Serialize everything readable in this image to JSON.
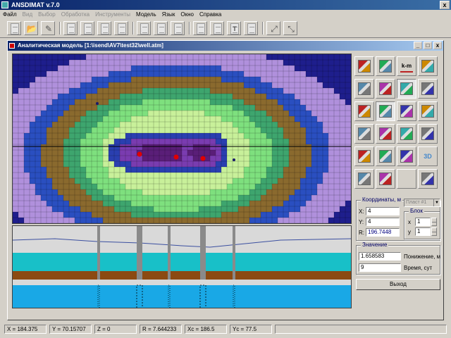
{
  "app": {
    "title": "ANSDIMAT v.7.0",
    "close_label": "x"
  },
  "menu": [
    {
      "label": "Файл",
      "enabled": true
    },
    {
      "label": "Вид",
      "enabled": false
    },
    {
      "label": "Выбор",
      "enabled": false
    },
    {
      "label": "Обработка",
      "enabled": false
    },
    {
      "label": "Инструменты",
      "enabled": false
    },
    {
      "label": "Модель",
      "enabled": true
    },
    {
      "label": "Язык",
      "enabled": true
    },
    {
      "label": "Окно",
      "enabled": true
    },
    {
      "label": "Справка",
      "enabled": true
    }
  ],
  "toolbar": {
    "icons": [
      "new-document-icon",
      "open-folder-icon",
      "edit-pencil-icon",
      "document-icon",
      "document-icon",
      "document-icon",
      "document-icon",
      "document-icon",
      "document-icon",
      "document-icon",
      "document-icon",
      "document-icon",
      "document-icon",
      "text-document-icon",
      "document-icon",
      "expand-arrows-icon",
      "collapse-arrows-icon"
    ],
    "glyphs": {
      "text": "T",
      "expand": "⤢",
      "collapse": "⤡"
    }
  },
  "child_window": {
    "title": "Аналитическая модель  [1:\\isend\\AV7\\test32\\well.atm]",
    "buttons": {
      "minimize": "_",
      "maximize": "□",
      "close": "x"
    }
  },
  "panel_buttons": [
    "layer-profile-icon",
    "well-icon",
    "km-icon",
    "map-points-icon",
    "zoom-region-icon",
    "compress-icon",
    "window-view-icon",
    "table-grid-icon",
    "crosshair-icon",
    "graph-curve-icon",
    "funnel-down-icon",
    "funnel-icon",
    "grid-select-icon",
    "bar-chart-icon",
    "export-chart-icon",
    "grid-icon",
    "grid-list-icon",
    "color-grid-icon",
    "film-reel-icon",
    "3d-view-icon",
    "image-stack-icon",
    "import-doc-icon",
    "blank-icon",
    "cancel-pen-icon"
  ],
  "panel_icon_text": {
    "km": "k-m",
    "three_d": "3D"
  },
  "coords": {
    "group_label": "Координаты, м",
    "x_label": "X:",
    "x_value": "4",
    "y_label": "Y:",
    "y_value": "4",
    "r_label": "R:",
    "r_value": "196.7448",
    "layer_select": "Пласт #1",
    "block_label": "Блок",
    "bx_label": "x",
    "bx_value": "1",
    "by_label": "y",
    "by_value": "1"
  },
  "value_group": {
    "group_label": "Значение",
    "value": "1.658583",
    "value_label": "Понижение, м",
    "time": "9",
    "time_label": "Время, сут"
  },
  "exit_label": "Выход",
  "status": [
    "X = 184.375",
    "Y = 70.15707",
    "Z = 0",
    "R = 7.644233",
    "Xc = 186.5",
    "Yc = 77.5"
  ],
  "colors": {
    "contour_levels": [
      "#1e1e8c",
      "#b090dc",
      "#2a4fc0",
      "#8a6a2e",
      "#3ea56e",
      "#7ee07e",
      "#c8f09a",
      "#2a3fb0",
      "#7a3cb0",
      "#5a1e78"
    ],
    "wells": "#e00000"
  }
}
